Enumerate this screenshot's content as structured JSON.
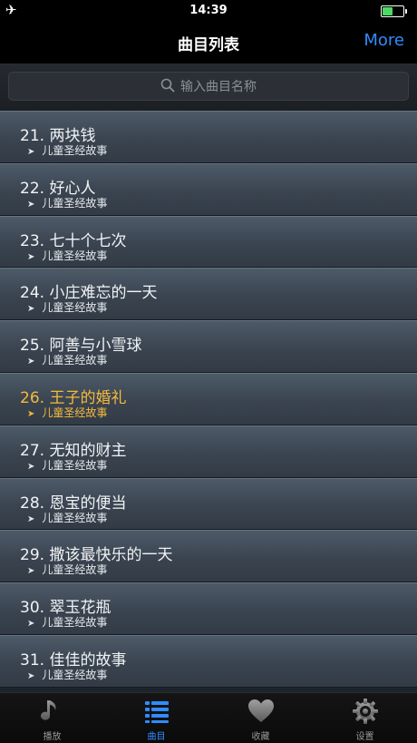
{
  "status": {
    "time": "14:39",
    "battery_level": 0.55
  },
  "nav": {
    "title": "曲目列表",
    "more": "More"
  },
  "search": {
    "placeholder": "输入曲目名称"
  },
  "songs": [
    {
      "title": "21. 两块钱",
      "sub": "儿童圣经故事",
      "active": false
    },
    {
      "title": "22. 好心人",
      "sub": "儿童圣经故事",
      "active": false
    },
    {
      "title": "23. 七十个七次",
      "sub": "儿童圣经故事",
      "active": false
    },
    {
      "title": "24. 小庄难忘的一天",
      "sub": "儿童圣经故事",
      "active": false
    },
    {
      "title": "25. 阿善与小雪球",
      "sub": "儿童圣经故事",
      "active": false
    },
    {
      "title": "26. 王子的婚礼",
      "sub": "儿童圣经故事",
      "active": true
    },
    {
      "title": "27. 无知的财主",
      "sub": "儿童圣经故事",
      "active": false
    },
    {
      "title": "28. 恩宝的便当",
      "sub": "儿童圣经故事",
      "active": false
    },
    {
      "title": "29. 撒该最快乐的一天",
      "sub": "儿童圣经故事",
      "active": false
    },
    {
      "title": "30. 翠玉花瓶",
      "sub": "儿童圣经故事",
      "active": false
    },
    {
      "title": "31. 佳佳的故事",
      "sub": "儿童圣经故事",
      "active": false
    }
  ],
  "tabs": [
    {
      "label": "播放",
      "icon": "music-note-icon"
    },
    {
      "label": "曲目",
      "icon": "list-icon"
    },
    {
      "label": "收藏",
      "icon": "heart-icon"
    },
    {
      "label": "设置",
      "icon": "gear-icon"
    }
  ],
  "active_tab": 1,
  "colors": {
    "accent": "#2f8cff",
    "highlight": "#f5b93c"
  }
}
